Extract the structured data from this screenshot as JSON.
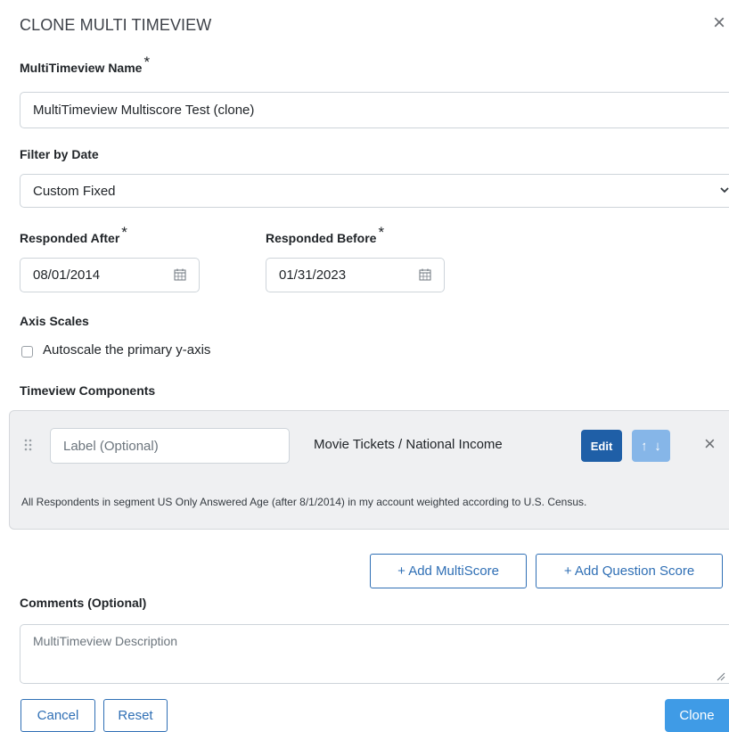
{
  "dialog": {
    "title": "CLONE MULTI TIMEVIEW",
    "close_glyph": "×"
  },
  "required_mark": "*",
  "name_field": {
    "label": "MultiTimeview Name",
    "value": "MultiTimeview Multiscore Test (clone)"
  },
  "filter_by_date": {
    "label": "Filter by Date",
    "selected": "Custom Fixed"
  },
  "responded_after": {
    "label": "Responded After",
    "value": "08/01/2014"
  },
  "responded_before": {
    "label": "Responded Before",
    "value": "01/31/2023"
  },
  "axis_scales": {
    "label": "Axis Scales",
    "autoscale_label": "Autoscale the primary y-axis",
    "autoscale_checked": false
  },
  "components": {
    "label": "Timeview Components",
    "items": [
      {
        "label_placeholder": "Label (Optional)",
        "name": "Movie Tickets / National Income",
        "edit_label": "Edit",
        "up_glyph": "↑",
        "down_glyph": "↓",
        "remove_glyph": "×",
        "description": "All Respondents in segment US Only Answered Age (after 8/1/2014) in my account weighted according to U.S. Census."
      }
    ],
    "add_multiscore_label": "+ Add MultiScore",
    "add_question_score_label": "+ Add Question Score"
  },
  "comments": {
    "label": "Comments (Optional)",
    "placeholder": "MultiTimeview Description"
  },
  "footer": {
    "cancel_label": "Cancel",
    "reset_label": "Reset",
    "clone_label": "Clone"
  },
  "colors": {
    "primary": "#3f9be6",
    "edit": "#1f5fa7",
    "arrow": "#86b6e8",
    "outline": "#2f6fb5",
    "panel_bg": "#eff0f2"
  },
  "icons": [
    "close-icon",
    "chevron-down-icon",
    "calendar-icon",
    "drag-handle-icon",
    "arrow-up-icon",
    "arrow-down-icon",
    "remove-icon",
    "resize-grip-icon"
  ]
}
